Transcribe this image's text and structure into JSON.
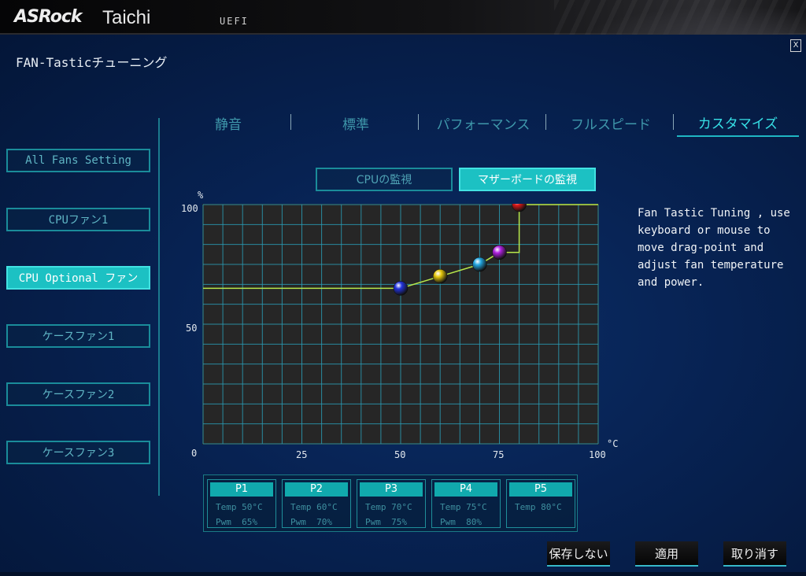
{
  "header": {
    "brand": "ASRock",
    "product": "Taichi",
    "mode": "UEFI",
    "close_label": "X"
  },
  "page": {
    "title": "FAN-Tasticチューニング"
  },
  "fans": [
    {
      "label": "All Fans Setting",
      "active": false
    },
    {
      "label": "CPUファン1",
      "active": false
    },
    {
      "label": "CPU Optional ファン",
      "active": true
    },
    {
      "label": "ケースファン1",
      "active": false
    },
    {
      "label": "ケースファン2",
      "active": false
    },
    {
      "label": "ケースファン3",
      "active": false
    }
  ],
  "tabs": [
    {
      "label": "静音",
      "active": false
    },
    {
      "label": "標準",
      "active": false
    },
    {
      "label": "パフォーマンス",
      "active": false
    },
    {
      "label": "フルスピード",
      "active": false
    },
    {
      "label": "カスタマイズ",
      "active": true
    }
  ],
  "monitor": {
    "cpu_label": "CPUの監視",
    "mb_label": "マザーボードの監視",
    "selected": "mb"
  },
  "help_text": "Fan Tastic Tuning , use keyboard or mouse to move drag-point and adjust fan temperature and power.",
  "chart_data": {
    "type": "line",
    "x_unit": "°C",
    "y_unit": "%",
    "xlim": [
      0,
      100
    ],
    "ylim": [
      0,
      100
    ],
    "x_ticks": [
      "0",
      "25",
      "50",
      "75",
      "100"
    ],
    "y_ticks": [
      "0",
      "50",
      "100"
    ],
    "grid": true,
    "series": [
      {
        "x": [
          0,
          50,
          60,
          70,
          75,
          80,
          80,
          100
        ],
        "y": [
          65,
          65,
          70,
          75,
          80,
          80,
          100,
          100
        ]
      }
    ],
    "points": [
      {
        "x": 50,
        "y": 65,
        "color": "#2233dd"
      },
      {
        "x": 60,
        "y": 70,
        "color": "#e6c80c"
      },
      {
        "x": 70,
        "y": 75,
        "color": "#22a6e0"
      },
      {
        "x": 75,
        "y": 80,
        "color": "#b020e0"
      },
      {
        "x": 80,
        "y": 100,
        "color": "#e01818"
      }
    ],
    "colors": {
      "line": "#b8e84a",
      "grid": "#2a9bb4",
      "plot_bg": "#262626"
    }
  },
  "points_table": [
    {
      "name": "P1",
      "temp": "Temp 50°C",
      "pwm": "Pwm  65%"
    },
    {
      "name": "P2",
      "temp": "Temp 60°C",
      "pwm": "Pwm  70%"
    },
    {
      "name": "P3",
      "temp": "Temp 70°C",
      "pwm": "Pwm  75%"
    },
    {
      "name": "P4",
      "temp": "Temp 75°C",
      "pwm": "Pwm  80%"
    },
    {
      "name": "P5",
      "temp": "Temp 80°C",
      "pwm": ""
    }
  ],
  "buttons": {
    "discard": "保存しない",
    "apply": "適用",
    "cancel": "取り消す"
  }
}
